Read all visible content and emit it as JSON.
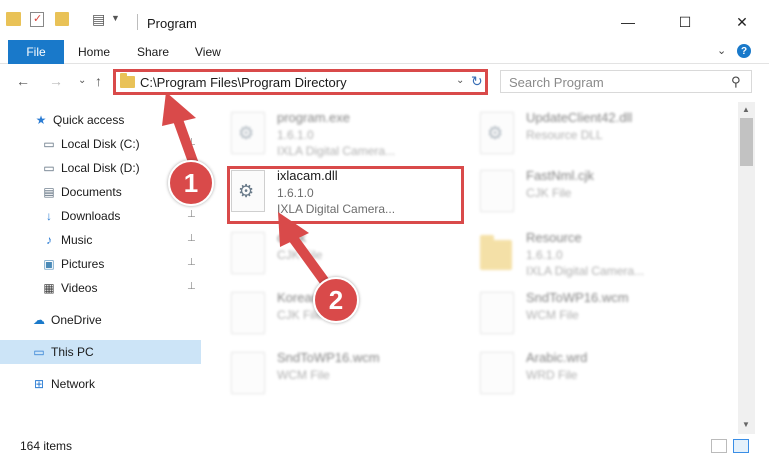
{
  "window": {
    "title": "Program",
    "controls": {
      "minimize": "—",
      "maximize": "☐",
      "close": "✕"
    }
  },
  "ribbon": {
    "tabs": [
      "File",
      "Home",
      "Share",
      "View"
    ],
    "expand": "⌄",
    "help": "?"
  },
  "address": {
    "path": "C:\\Program Files\\Program Directory",
    "search_placeholder": "Search Program",
    "back": "←",
    "forward": "→",
    "recent": "⌄",
    "up": "↑",
    "dropdown": "⌄",
    "refresh": "↻",
    "search_glyph": "⚲"
  },
  "sidebar": {
    "items": [
      {
        "label": "Quick access",
        "icon": "star-icon",
        "glyph": "★",
        "color": "#2b7cd3",
        "pinned": false
      },
      {
        "label": "Local Disk (C:)",
        "icon": "drive-icon",
        "glyph": "▭",
        "color": "#5a6b7b",
        "pinned": true
      },
      {
        "label": "Local Disk (D:)",
        "icon": "drive-icon",
        "glyph": "▭",
        "color": "#5a6b7b",
        "pinned": true
      },
      {
        "label": "Documents",
        "icon": "documents-icon",
        "glyph": "▤",
        "color": "#5a6b7b",
        "pinned": true
      },
      {
        "label": "Downloads",
        "icon": "downloads-icon",
        "glyph": "↓",
        "color": "#2b7cd3",
        "pinned": true
      },
      {
        "label": "Music",
        "icon": "music-icon",
        "glyph": "♪",
        "color": "#2b7cd3",
        "pinned": true
      },
      {
        "label": "Pictures",
        "icon": "pictures-icon",
        "glyph": "▣",
        "color": "#4a8ab8",
        "pinned": true
      },
      {
        "label": "Videos",
        "icon": "videos-icon",
        "glyph": "▦",
        "color": "#444444",
        "pinned": true
      },
      {
        "label": "OneDrive",
        "icon": "onedrive-icon",
        "glyph": "☁",
        "color": "#1979ca",
        "pinned": false
      },
      {
        "label": "This PC",
        "icon": "this-pc-icon",
        "glyph": "▭",
        "color": "#2b7cd3",
        "pinned": false,
        "selected": true
      },
      {
        "label": "Network",
        "icon": "network-icon",
        "glyph": "⊞",
        "color": "#2b7cd3",
        "pinned": false
      }
    ],
    "pin_glyph": "📌"
  },
  "files": [
    {
      "name": "program.exe",
      "line2": "1.6.1.0",
      "line3": "IXLA Digital Camera...",
      "blurred": true,
      "kind": "gear"
    },
    {
      "name": "UpdateClient42.dll",
      "line2": "Resource DLL",
      "line3": "",
      "blurred": true,
      "kind": "gear"
    },
    {
      "name": "ixlacam.dll",
      "line2": "1.6.1.0",
      "line3": "IXLA Digital Camera...",
      "blurred": false,
      "kind": "gear"
    },
    {
      "name": "FastNml.cjk",
      "line2": "CJK File",
      "line3": "",
      "blurred": true,
      "kind": "blank"
    },
    {
      "name": "ci.cjk",
      "line2": "CJK File",
      "line3": "",
      "blurred": true,
      "kind": "blank"
    },
    {
      "name": "Resource",
      "line2": "1.6.1.0",
      "line3": "IXLA Digital Camera...",
      "blurred": true,
      "kind": "folder"
    },
    {
      "name": "Korean.cjk",
      "line2": "CJK File",
      "line3": "",
      "blurred": true,
      "kind": "blank"
    },
    {
      "name": "SndToWP16.wcm",
      "line2": "WCM File",
      "line3": "",
      "blurred": true,
      "kind": "blank"
    },
    {
      "name": "SndToWP16.wcm",
      "line2": "WCM File",
      "line3": "",
      "blurred": true,
      "kind": "blank"
    },
    {
      "name": "Arabic.wrd",
      "line2": "WRD File",
      "line3": "",
      "blurred": true,
      "kind": "blank"
    }
  ],
  "gear_glyph": "⚙",
  "status": {
    "item_count": "164 items"
  },
  "annotations": {
    "step1": "1",
    "step2": "2",
    "color": "#d94a4a"
  },
  "scroll": {
    "up": "▲",
    "down": "▼"
  }
}
